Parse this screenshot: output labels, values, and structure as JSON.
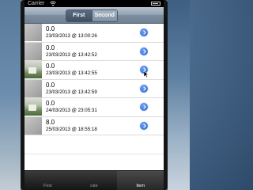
{
  "status_bar": {
    "carrier": "Carrier",
    "time": ""
  },
  "segmented_control": {
    "options": [
      "First",
      "Second"
    ],
    "selected": "First"
  },
  "rows": [
    {
      "value": "0.0",
      "date": "23/03/2013 @ 13:00:26",
      "thumbnail": "plain"
    },
    {
      "value": "0.0",
      "date": "23/03/2013 @ 13:42:52",
      "thumbnail": "plain"
    },
    {
      "value": "0.0",
      "date": "23/03/2013 @ 13:42:55",
      "thumbnail": "photo"
    },
    {
      "value": "0.0",
      "date": "23/03/2013 @ 13:42:59",
      "thumbnail": "plain"
    },
    {
      "value": "0.0",
      "date": "24/03/2013 @ 23:05:31",
      "thumbnail": "photo"
    },
    {
      "value": "8.0",
      "date": "25/03/2013 @ 18:55:18",
      "thumbnail": "plain"
    }
  ],
  "tabs": [
    {
      "label": "First",
      "active": false
    },
    {
      "label": "rate",
      "active": false
    },
    {
      "label": "Item",
      "active": true
    }
  ],
  "colors": {
    "accent": "#1f5fd1",
    "navbar": "#8fa0b1",
    "tabbar": "#151515"
  }
}
